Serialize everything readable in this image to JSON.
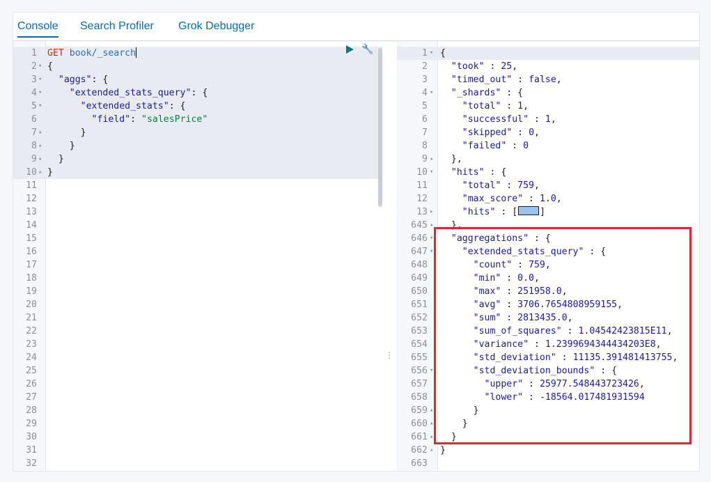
{
  "tabs": [
    {
      "label": "Console",
      "active": true
    },
    {
      "label": "Search Profiler",
      "active": false
    },
    {
      "label": "Grok Debugger",
      "active": false
    }
  ],
  "request": {
    "method": "GET",
    "path": "book/_search",
    "lines": [
      {
        "n": "1",
        "fold": "",
        "text": ""
      },
      {
        "n": "2",
        "fold": "▾",
        "text": "{"
      },
      {
        "n": "3",
        "fold": "▾",
        "text": "  \"aggs\": {"
      },
      {
        "n": "4",
        "fold": "▾",
        "text": "    \"extended_stats_query\": {"
      },
      {
        "n": "5",
        "fold": "▾",
        "text": "      \"extended_stats\": {"
      },
      {
        "n": "6",
        "fold": "",
        "text": "        \"field\": \"salesPrice\""
      },
      {
        "n": "7",
        "fold": "▴",
        "text": "      }"
      },
      {
        "n": "8",
        "fold": "▴",
        "text": "    }"
      },
      {
        "n": "9",
        "fold": "▴",
        "text": "  }"
      },
      {
        "n": "10",
        "fold": "▴",
        "text": "}"
      },
      {
        "n": "11",
        "fold": "",
        "text": ""
      },
      {
        "n": "12",
        "fold": "",
        "text": ""
      },
      {
        "n": "13",
        "fold": "",
        "text": ""
      },
      {
        "n": "14",
        "fold": "",
        "text": ""
      },
      {
        "n": "15",
        "fold": "",
        "text": ""
      },
      {
        "n": "16",
        "fold": "",
        "text": ""
      },
      {
        "n": "17",
        "fold": "",
        "text": ""
      },
      {
        "n": "18",
        "fold": "",
        "text": ""
      },
      {
        "n": "19",
        "fold": "",
        "text": ""
      },
      {
        "n": "20",
        "fold": "",
        "text": ""
      },
      {
        "n": "21",
        "fold": "",
        "text": ""
      },
      {
        "n": "22",
        "fold": "",
        "text": ""
      },
      {
        "n": "23",
        "fold": "",
        "text": ""
      },
      {
        "n": "24",
        "fold": "",
        "text": ""
      },
      {
        "n": "25",
        "fold": "",
        "text": ""
      },
      {
        "n": "26",
        "fold": "",
        "text": ""
      },
      {
        "n": "27",
        "fold": "",
        "text": ""
      },
      {
        "n": "28",
        "fold": "",
        "text": ""
      },
      {
        "n": "29",
        "fold": "",
        "text": ""
      },
      {
        "n": "30",
        "fold": "",
        "text": ""
      },
      {
        "n": "31",
        "fold": "",
        "text": ""
      },
      {
        "n": "32",
        "fold": "",
        "text": ""
      }
    ]
  },
  "icons": {
    "run": "play-icon",
    "settings": "wrench-icon",
    "divider": "drag-handle-icon"
  },
  "response": {
    "lines": [
      {
        "n": "1",
        "fold": "▾",
        "text": "{"
      },
      {
        "n": "2",
        "fold": "",
        "text": "  \"took\" : 25,"
      },
      {
        "n": "3",
        "fold": "",
        "text": "  \"timed_out\" : false,"
      },
      {
        "n": "4",
        "fold": "▾",
        "text": "  \"_shards\" : {"
      },
      {
        "n": "5",
        "fold": "",
        "text": "    \"total\" : 1,"
      },
      {
        "n": "6",
        "fold": "",
        "text": "    \"successful\" : 1,"
      },
      {
        "n": "7",
        "fold": "",
        "text": "    \"skipped\" : 0,"
      },
      {
        "n": "8",
        "fold": "",
        "text": "    \"failed\" : 0"
      },
      {
        "n": "9",
        "fold": "▴",
        "text": "  },"
      },
      {
        "n": "10",
        "fold": "▾",
        "text": "  \"hits\" : {"
      },
      {
        "n": "11",
        "fold": "",
        "text": "    \"total\" : 759,"
      },
      {
        "n": "12",
        "fold": "",
        "text": "    \"max_score\" : 1.0,"
      },
      {
        "n": "13",
        "fold": "▸",
        "text": "    \"hits\" : [@]"
      },
      {
        "n": "645",
        "fold": "▴",
        "text": "  },"
      },
      {
        "n": "646",
        "fold": "▾",
        "text": "  \"aggregations\" : {"
      },
      {
        "n": "647",
        "fold": "▾",
        "text": "    \"extended_stats_query\" : {"
      },
      {
        "n": "648",
        "fold": "",
        "text": "      \"count\" : 759,"
      },
      {
        "n": "649",
        "fold": "",
        "text": "      \"min\" : 0.0,"
      },
      {
        "n": "650",
        "fold": "",
        "text": "      \"max\" : 251958.0,"
      },
      {
        "n": "651",
        "fold": "",
        "text": "      \"avg\" : 3706.7654808959155,"
      },
      {
        "n": "652",
        "fold": "",
        "text": "      \"sum\" : 2813435.0,"
      },
      {
        "n": "653",
        "fold": "",
        "text": "      \"sum_of_squares\" : 1.04542423815E11,"
      },
      {
        "n": "654",
        "fold": "",
        "text": "      \"variance\" : 1.2399694344434203E8,"
      },
      {
        "n": "655",
        "fold": "",
        "text": "      \"std_deviation\" : 11135.391481413755,"
      },
      {
        "n": "656",
        "fold": "▾",
        "text": "      \"std_deviation_bounds\" : {"
      },
      {
        "n": "657",
        "fold": "",
        "text": "        \"upper\" : 25977.548443723426,"
      },
      {
        "n": "658",
        "fold": "",
        "text": "        \"lower\" : -18564.017481931594"
      },
      {
        "n": "659",
        "fold": "▴",
        "text": "      }"
      },
      {
        "n": "660",
        "fold": "▴",
        "text": "    }"
      },
      {
        "n": "661",
        "fold": "▴",
        "text": "  }"
      },
      {
        "n": "662",
        "fold": "▴",
        "text": "}"
      },
      {
        "n": "663",
        "fold": "",
        "text": ""
      }
    ]
  },
  "colors": {
    "accent": "#006bb4",
    "highlight_box": "#e4262c",
    "method": "#c32e10"
  }
}
